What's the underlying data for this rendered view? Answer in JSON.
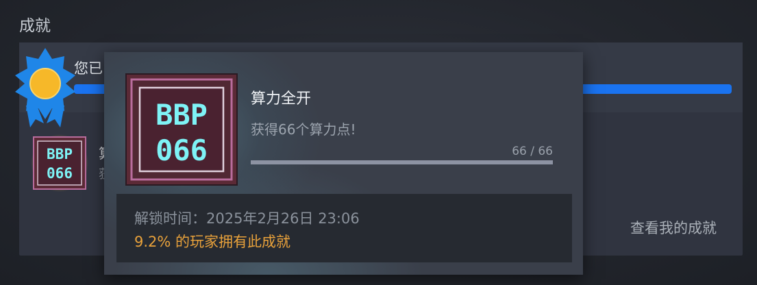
{
  "section": {
    "title": "成就"
  },
  "summary": {
    "text": "您已",
    "progress": 1.0
  },
  "achievement_row": {
    "icon": "bbp-066-achievement-icon",
    "icon_lines": [
      "BBP",
      "066"
    ],
    "name": "算",
    "desc": "获"
  },
  "view_link": "查看我的成就",
  "tooltip": {
    "name": "算力全开",
    "desc": "获得66个算力点!",
    "progress_text": "66 / 66",
    "progress": 1.0,
    "unlock_time": "解锁时间：2025年2月26日 23:06",
    "rarity": "9.2% 的玩家拥有此成就"
  },
  "colors": {
    "accent_blue": "#1a73f0",
    "rarity_gold": "#e9a23b",
    "badge_blue": "#1f86e8",
    "badge_gold": "#f6b829"
  },
  "icons": {
    "badge": "achievement-medal-icon"
  }
}
